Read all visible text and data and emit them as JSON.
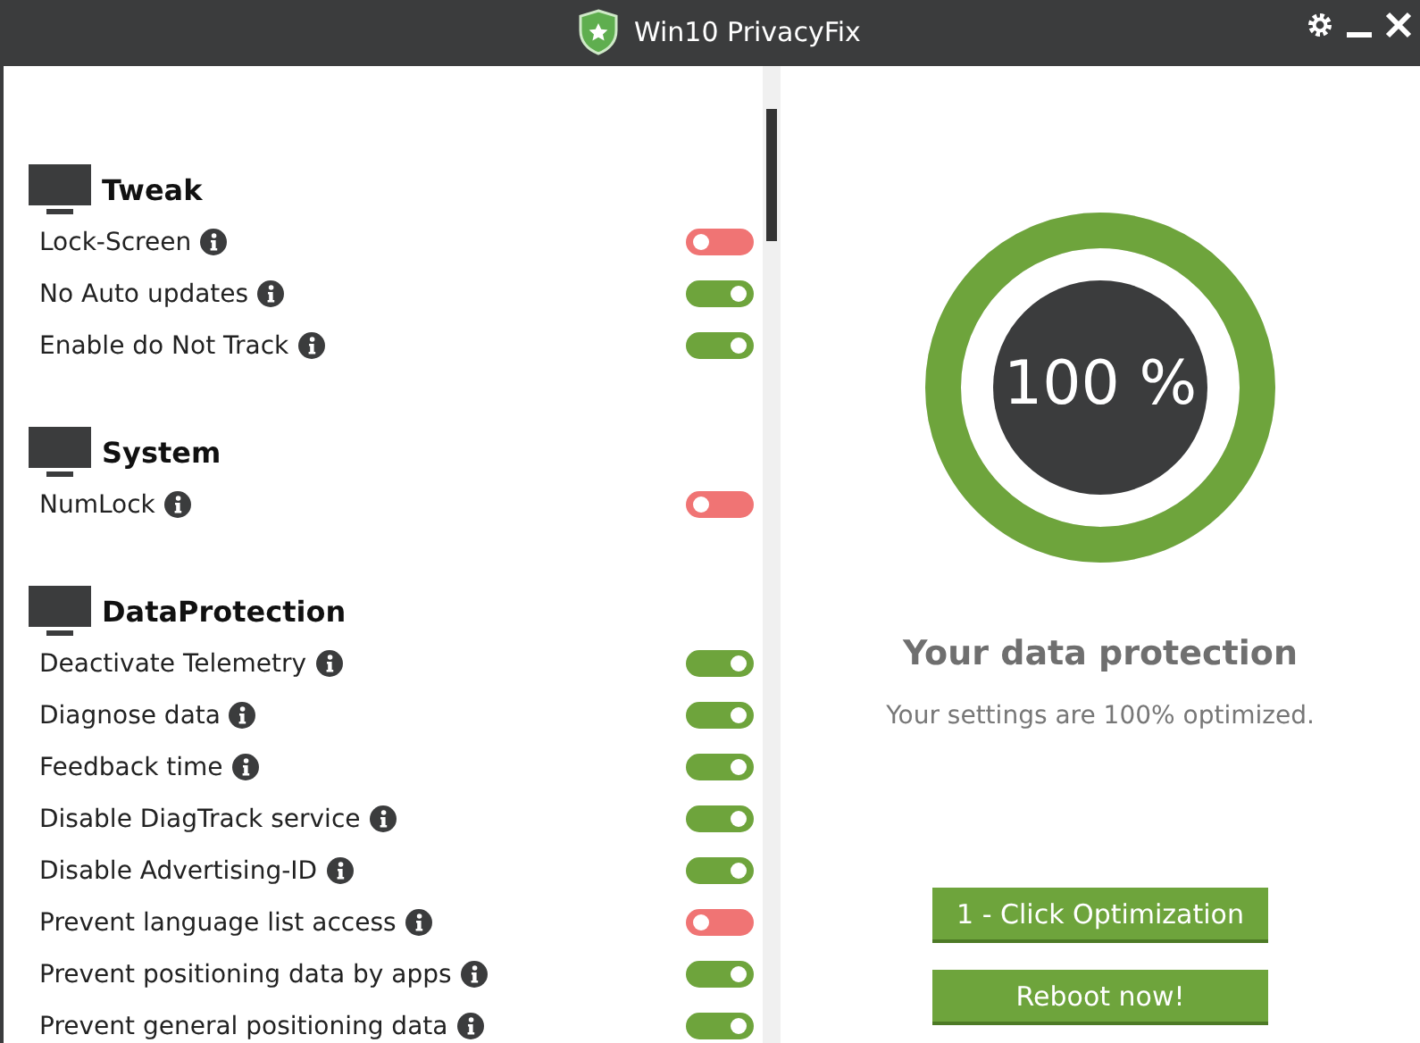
{
  "window": {
    "title": "Win10 PrivacyFix"
  },
  "sections": [
    {
      "title": "Tweak",
      "items": [
        {
          "label": "Lock-Screen",
          "on": false
        },
        {
          "label": "No Auto updates",
          "on": true
        },
        {
          "label": "Enable do Not Track",
          "on": true
        }
      ]
    },
    {
      "title": "System",
      "items": [
        {
          "label": "NumLock",
          "on": false
        }
      ]
    },
    {
      "title": "DataProtection",
      "items": [
        {
          "label": "Deactivate Telemetry",
          "on": true
        },
        {
          "label": "Diagnose data",
          "on": true
        },
        {
          "label": "Feedback time",
          "on": true
        },
        {
          "label": "Disable DiagTrack service",
          "on": true
        },
        {
          "label": "Disable Advertising-ID",
          "on": true
        },
        {
          "label": "Prevent language list access",
          "on": false
        },
        {
          "label": "Prevent positioning data by apps",
          "on": true
        },
        {
          "label": "Prevent general positioning data",
          "on": true
        }
      ]
    }
  ],
  "status": {
    "level": 1,
    "percent": "100 %",
    "heading": "Your data protection",
    "message": "Your settings are 100% optimized."
  },
  "buttons": [
    "1 - Click Optimization",
    "Reboot now!"
  ]
}
